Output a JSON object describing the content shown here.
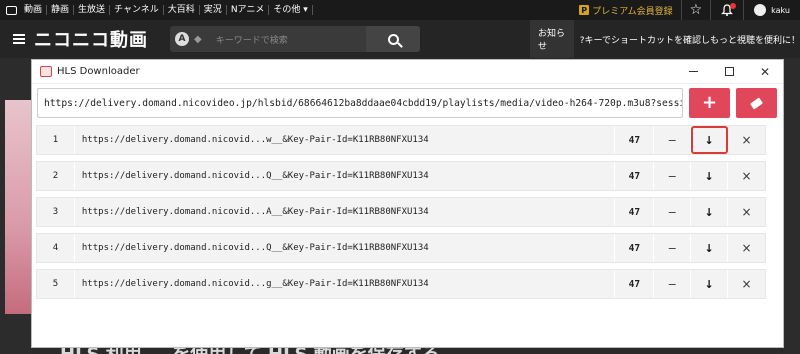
{
  "topbar": {
    "nav": [
      "動画",
      "静画",
      "生放送",
      "チャンネル",
      "大百科",
      "実況",
      "Nアニメ",
      "その他 ▾"
    ],
    "premium": "プレミアム会員登録",
    "premium_badge": "P",
    "user": "kaku"
  },
  "header": {
    "logo": "ニコニコ動画",
    "search_badge": "A",
    "search_placeholder": "キーワードで検索",
    "notice_label": "お知らせ",
    "notice_text": "?キーでショートカットを確認しもっと視聴を便利に！"
  },
  "background": {
    "bottom_text": "HLS 利用 … を使用して HLS 動画を保存する"
  },
  "window": {
    "title": "HLS Downloader",
    "url_value": "https://delivery.domand.nicovideo.jp/hlsbid/68664612ba8ddaae04cbdd19/playlists/media/video-h264-720p.m3u8?session",
    "rows": [
      {
        "index": "1",
        "url": "https://delivery.domand.nicovid...w__&Key-Pair-Id=K11RB80NFXU134",
        "count": "47",
        "dash": "−",
        "download": "↓",
        "close": "×"
      },
      {
        "index": "2",
        "url": "https://delivery.domand.nicovid...Q__&Key-Pair-Id=K11RB80NFXU134",
        "count": "47",
        "dash": "−",
        "download": "↓",
        "close": "×"
      },
      {
        "index": "3",
        "url": "https://delivery.domand.nicovid...A__&Key-Pair-Id=K11RB80NFXU134",
        "count": "47",
        "dash": "−",
        "download": "↓",
        "close": "×"
      },
      {
        "index": "4",
        "url": "https://delivery.domand.nicovid...Q__&Key-Pair-Id=K11RB80NFXU134",
        "count": "47",
        "dash": "−",
        "download": "↓",
        "close": "×"
      },
      {
        "index": "5",
        "url": "https://delivery.domand.nicovid...g__&Key-Pair-Id=K11RB80NFXU134",
        "count": "47",
        "dash": "−",
        "download": "↓",
        "close": "×"
      }
    ]
  },
  "colors": {
    "accent_red": "#e0475b",
    "highlight_outline": "#d93a3a",
    "premium_gold": "#e0b23a"
  }
}
